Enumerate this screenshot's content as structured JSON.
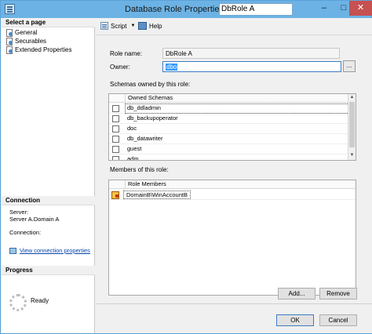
{
  "window": {
    "title": "Database Role Properties -",
    "role_name_in_title": "DbRole A",
    "minimize": "–",
    "maximize": "□",
    "close": "✕"
  },
  "left": {
    "select_page_heading": "Select a page",
    "pages": [
      "General",
      "Securables",
      "Extended Properties"
    ],
    "connection_heading": "Connection",
    "server_label": "Server:",
    "server_value": "Server A.Domain A",
    "connection_label": "Connection:",
    "view_connection_link": "View connection properties",
    "progress_heading": "Progress",
    "progress_status": "Ready"
  },
  "toolbar": {
    "script_label": "Script",
    "help_label": "Help"
  },
  "general": {
    "role_name_label": "Role name:",
    "role_name_value": "DbRole A",
    "owner_label": "Owner:",
    "owner_value": "dbo",
    "browse_label": "...",
    "schemas_label": "Schemas owned by this role:",
    "schemas_header": "Owned Schemas",
    "schemas": [
      "db_ddladmin",
      "db_backupoperator",
      "doc",
      "db_datawriter",
      "guest",
      "adm"
    ],
    "members_label": "Members of this role:",
    "members_header": "Role Members",
    "members": [
      "DomainB\\WinAccountB"
    ],
    "add_label": "Add...",
    "remove_label": "Remove"
  },
  "footer": {
    "ok_label": "OK",
    "cancel_label": "Cancel"
  },
  "colors": {
    "titlebar": "#6cb2e4",
    "selection": "#3399ff",
    "close_button": "#c75050",
    "link": "#0645ad"
  }
}
